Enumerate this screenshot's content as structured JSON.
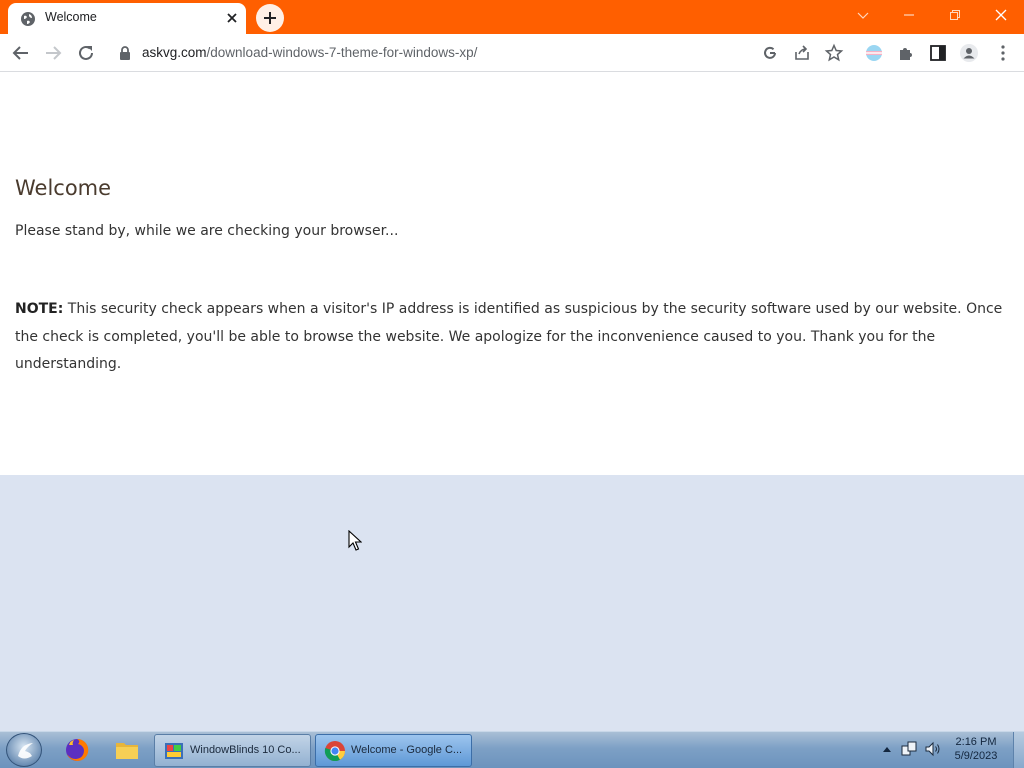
{
  "browser": {
    "tab": {
      "title": "Welcome"
    },
    "address": {
      "host": "askvg.com",
      "path": "/download-windows-7-theme-for-windows-xp/"
    },
    "colors": {
      "titlebar": "#ff5f00",
      "toolbar": "#ffffff"
    }
  },
  "page": {
    "heading": "Welcome",
    "standby": "Please stand by, while we are checking your browser...",
    "note_label": "NOTE:",
    "note_text": " This security check appears when a visitor's IP address is identified as suspicious by the security software used by our website. Once the check is completed, you'll be able to browse the website. We apologize for the inconvenience caused to you. Thank you for the understanding."
  },
  "taskbar": {
    "windows": [
      {
        "label": "WindowBlinds 10 Co...",
        "icon": "windowblinds-icon",
        "active": false
      },
      {
        "label": "Welcome - Google C...",
        "icon": "chrome-icon",
        "active": true
      }
    ],
    "clock": {
      "time": "2:16 PM",
      "date": "5/9/2023"
    }
  }
}
